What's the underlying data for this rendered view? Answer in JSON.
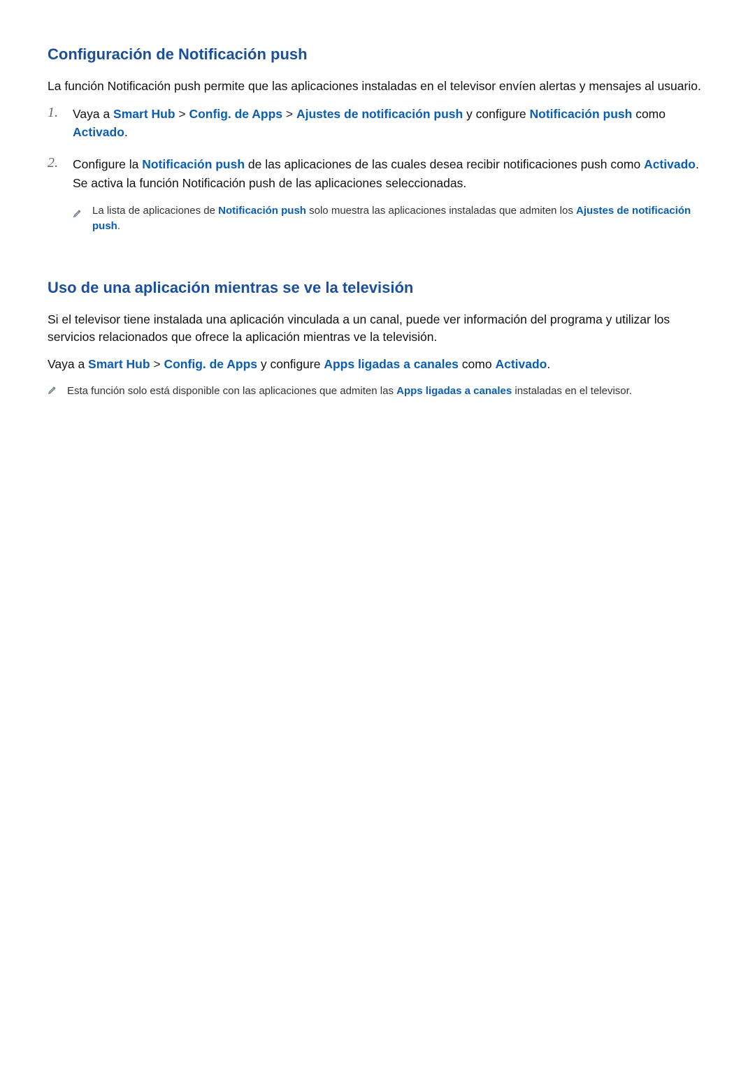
{
  "section1": {
    "title": "Configuración de Notificación push",
    "intro": "La función Notificación push permite que las aplicaciones instaladas en el televisor envíen alertas y mensajes al usuario.",
    "step1": {
      "num": "1.",
      "pre": "Vaya a ",
      "smart_hub": "Smart Hub",
      "gt1": " > ",
      "config_apps": "Config. de Apps",
      "gt2": " > ",
      "ajustes": "Ajustes de notificación push",
      "mid": " y configure ",
      "notif": "Notificación push",
      "post": " como ",
      "activado": "Activado",
      "dot": "."
    },
    "step2": {
      "num": "2.",
      "pre": "Configure la ",
      "notif": "Notificación push",
      "mid1": " de las aplicaciones de las cuales desea recibir notificaciones push como ",
      "activado": "Activado",
      "mid2": ". Se activa la función Notificación push de las aplicaciones seleccionadas."
    },
    "note": {
      "pre": "La lista de aplicaciones de ",
      "notif": "Notificación push",
      "mid": " solo muestra las aplicaciones instaladas que admiten los ",
      "ajustes": "Ajustes de notificación push",
      "dot": "."
    }
  },
  "section2": {
    "title": "Uso de una aplicación mientras se ve la televisión",
    "intro": "Si el televisor tiene instalada una aplicación vinculada a un canal, puede ver información del programa y utilizar los servicios relacionados que ofrece la aplicación mientras ve la televisión.",
    "path": {
      "pre": "Vaya a ",
      "smart_hub": "Smart Hub",
      "gt1": " > ",
      "config_apps": "Config. de Apps",
      "mid": " y configure ",
      "apps_canales": "Apps ligadas a canales",
      "post": " como ",
      "activado": "Activado",
      "dot": "."
    },
    "note": {
      "pre": "Esta función solo está disponible con las aplicaciones que admiten las ",
      "apps_canales": "Apps ligadas a canales",
      "post": " instaladas en el televisor."
    }
  }
}
